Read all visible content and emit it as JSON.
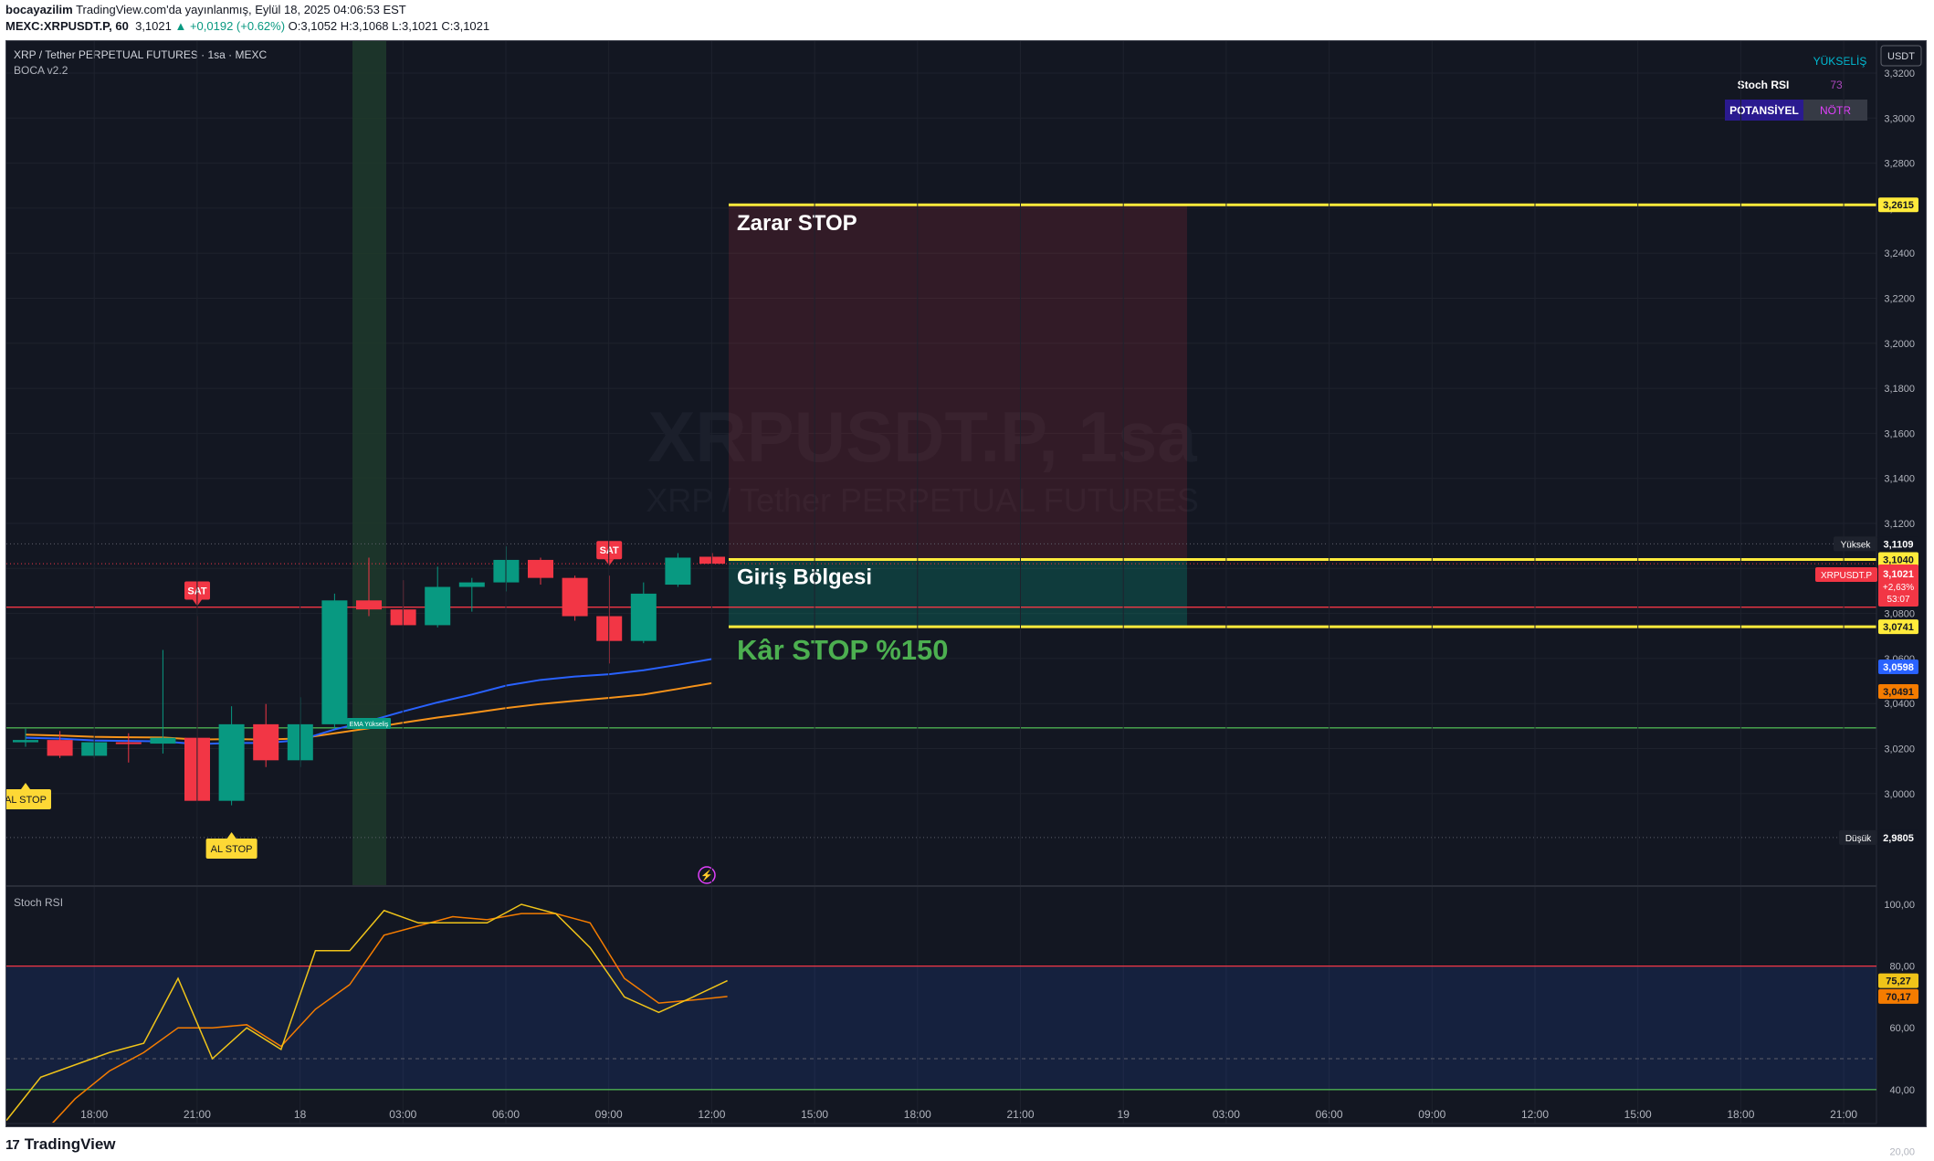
{
  "header": {
    "line1_user": "bocayazilim",
    "line1_rest": "TradingView.com'da yayınlanmış, Eylül 18, 2025 04:06:53 EST",
    "symbol": "MEXC:XRPUSDT.P, 60",
    "last": "3,1021",
    "change": "▲ +0,0192 (+0.62%)",
    "ohlc": "O:3,1052 H:3,1068 L:3,1021 C:3,1021"
  },
  "pane": {
    "title": "XRP / Tether PERPETUAL FUTURES · 1sa · MEXC",
    "indicator": "BOCA v2.2",
    "currency": "USDT",
    "watermark1": "XRPUSDT.P, 1sa",
    "watermark2": "XRP / Tether PERPETUAL FUTURES"
  },
  "table": {
    "trend": "YÜKSELİŞ",
    "stoch_label": "Stoch RSI",
    "stoch_value": "73",
    "potential": "POTANSİYEL",
    "neutral": "NÖTR"
  },
  "zones": {
    "stop_loss_label": "Zarar STOP",
    "entry_label": "Giriş Bölgesi",
    "take_profit_label": "Kâr STOP %150"
  },
  "price_tags": {
    "stop_loss": "3,2615",
    "high_label": "Yüksek",
    "high": "3,1109",
    "entry": "3,1040",
    "symbol_tag": "XRPUSDT.P",
    "last": "3,1021",
    "change_pct": "+2,63%",
    "countdown": "53:07",
    "take_profit": "3,0741",
    "ema_fast": "3,0598",
    "ema_slow": "3,0491",
    "low_label": "Düşük",
    "low": "2,9805"
  },
  "colors": {
    "background": "#131722",
    "bull": "#089981",
    "bear": "#f23645",
    "ema_fast": "#2962ff",
    "ema_slow": "#f7931a",
    "level": "#ffeb3b",
    "green_line": "#4caf50",
    "red_line": "#f23645",
    "stoch_k": "#f0c419",
    "stoch_d": "#f57c00"
  },
  "x_ticks": [
    "18:00",
    "21:00",
    "18",
    "03:00",
    "06:00",
    "09:00",
    "12:00",
    "15:00",
    "18:00",
    "21:00",
    "19",
    "03:00",
    "06:00",
    "09:00",
    "12:00",
    "15:00",
    "18:00",
    "21:00"
  ],
  "signals": [
    {
      "bar": 5,
      "text": "SAT",
      "kind": "sell"
    },
    {
      "bar": 17,
      "text": "SAT",
      "kind": "sell"
    },
    {
      "bar": 0,
      "text": "AL STOP",
      "kind": "buy"
    },
    {
      "bar": 6,
      "text": "AL STOP",
      "kind": "buy"
    },
    {
      "bar": 10,
      "text": "EMA Yükseliş",
      "kind": "ema"
    }
  ],
  "stoch": {
    "title": "Stoch RSI",
    "k_last": "75,27",
    "d_last": "70,17",
    "y_ticks": [
      "100,00",
      "80,00",
      "60,00",
      "40,00",
      "20,00"
    ]
  },
  "chart_data": {
    "type": "candlestick",
    "ylim": [
      2.97,
      3.33
    ],
    "y_ticks": [
      3.32,
      3.3,
      3.28,
      3.26,
      3.24,
      3.22,
      3.2,
      3.18,
      3.16,
      3.14,
      3.12,
      3.1,
      3.08,
      3.06,
      3.04,
      3.02,
      3.0
    ],
    "candles": [
      {
        "o": 3.0228,
        "h": 3.0288,
        "l": 3.0208,
        "c": 3.0238
      },
      {
        "o": 3.0238,
        "h": 3.0278,
        "l": 3.0158,
        "c": 3.0168
      },
      {
        "o": 3.0168,
        "h": 3.0238,
        "l": 3.0158,
        "c": 3.0228
      },
      {
        "o": 3.0228,
        "h": 3.0268,
        "l": 3.0138,
        "c": 3.0226
      },
      {
        "o": 3.0222,
        "h": 3.0638,
        "l": 3.0178,
        "c": 3.0248
      },
      {
        "o": 3.0248,
        "h": 3.0788,
        "l": 2.9998,
        "c": 2.9968
      },
      {
        "o": 2.9968,
        "h": 3.0388,
        "l": 2.9948,
        "c": 3.0308
      },
      {
        "o": 3.0308,
        "h": 3.0398,
        "l": 3.0118,
        "c": 3.0148
      },
      {
        "o": 3.0148,
        "h": 3.0428,
        "l": 3.0118,
        "c": 3.0308
      },
      {
        "o": 3.0308,
        "h": 3.0888,
        "l": 3.0288,
        "c": 3.0858
      },
      {
        "o": 3.0858,
        "h": 3.1048,
        "l": 3.0788,
        "c": 3.0818
      },
      {
        "o": 3.0818,
        "h": 3.0948,
        "l": 3.0758,
        "c": 3.0748
      },
      {
        "o": 3.0748,
        "h": 3.1008,
        "l": 3.0738,
        "c": 3.0918
      },
      {
        "o": 3.0918,
        "h": 3.0958,
        "l": 3.0808,
        "c": 3.0938
      },
      {
        "o": 3.0938,
        "h": 3.1098,
        "l": 3.0898,
        "c": 3.1038
      },
      {
        "o": 3.1038,
        "h": 3.1048,
        "l": 3.0928,
        "c": 3.0958
      },
      {
        "o": 3.0958,
        "h": 3.0968,
        "l": 3.0768,
        "c": 3.0788
      },
      {
        "o": 3.0788,
        "h": 3.0968,
        "l": 3.0578,
        "c": 3.0678
      },
      {
        "o": 3.0678,
        "h": 3.0938,
        "l": 3.0668,
        "c": 3.0888
      },
      {
        "o": 3.0928,
        "h": 3.1068,
        "l": 3.0918,
        "c": 3.1048
      },
      {
        "o": 3.1052,
        "h": 3.1068,
        "l": 3.1021,
        "c": 3.1021
      }
    ],
    "ema_fast": [
      3.0248,
      3.0244,
      3.0236,
      3.0234,
      3.0232,
      3.022,
      3.0225,
      3.0225,
      3.0238,
      3.0285,
      3.0322,
      3.0365,
      3.0405,
      3.044,
      3.048,
      3.0505,
      3.052,
      3.053,
      3.0548,
      3.0572,
      3.0598
    ],
    "ema_slow": [
      3.0262,
      3.0258,
      3.0252,
      3.025,
      3.0249,
      3.024,
      3.0242,
      3.024,
      3.0245,
      3.0268,
      3.029,
      3.0315,
      3.0338,
      3.0358,
      3.038,
      3.0398,
      3.0412,
      3.0425,
      3.044,
      3.0465,
      3.0491
    ],
    "levels": {
      "stop_loss": 3.2615,
      "entry": 3.104,
      "take_profit": 3.0741,
      "red_line": 3.0828,
      "green_line": 3.0292,
      "high": 3.1109,
      "low": 2.9805,
      "last": 3.1021
    },
    "stoch_ylim": [
      15,
      105
    ],
    "stoch_k": [
      30,
      44,
      48,
      52,
      55,
      76,
      50,
      60,
      53,
      85,
      85,
      98,
      94,
      94,
      94,
      100,
      97,
      86,
      70,
      65,
      70,
      75.27
    ],
    "stoch_d": [
      20,
      25,
      37,
      46,
      52,
      60,
      60,
      61,
      54,
      66,
      74,
      90,
      93,
      96,
      95,
      97,
      97,
      94,
      76,
      68,
      69,
      70.17
    ]
  }
}
